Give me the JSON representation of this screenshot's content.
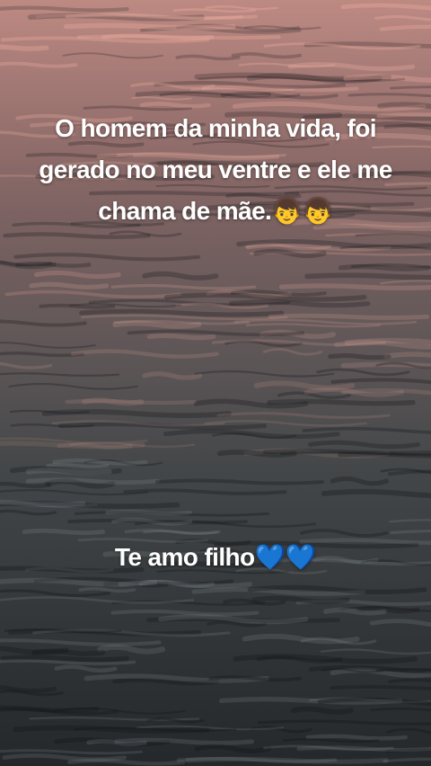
{
  "story": {
    "caption_top": {
      "lines": [
        "O homem da minha vida, foi",
        "gerado no meu ventre e ele me",
        "chama de mãe.👦👦"
      ]
    },
    "caption_bottom": "Te amo filho💙💙"
  },
  "background": {
    "description_colors": {
      "top": "#8a6566",
      "middle": "#4f4e50",
      "bottom": "#25282a"
    }
  }
}
